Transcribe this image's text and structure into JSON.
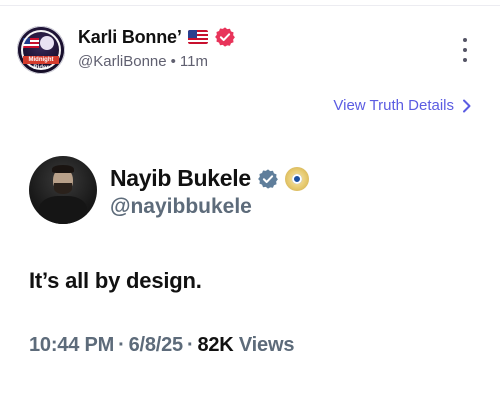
{
  "post": {
    "author_name": "Karli Bonne’",
    "author_handle": "@KarliBonne",
    "separator": "•",
    "time_ago": "11m",
    "avatar_label": "Midnight Rider"
  },
  "actions": {
    "view_details_label": "View Truth Details"
  },
  "embedded": {
    "name": "Nayib Bukele",
    "handle": "@nayibbukele",
    "text": "It’s all by design.",
    "time": "10:44 PM",
    "date": "6/8/25",
    "views_count": "82K",
    "views_label": "Views",
    "dot": "·"
  },
  "colors": {
    "accent": "#5b5ce2",
    "verified_red": "#e8345a",
    "verified_blue": "#5f7e9b",
    "muted": "#5d6b7a"
  },
  "icons": {
    "flag": "us-flag-icon",
    "verified": "verified-badge-icon",
    "more": "more-vertical-icon",
    "chevron": "chevron-right-icon",
    "government": "government-seal-icon"
  }
}
